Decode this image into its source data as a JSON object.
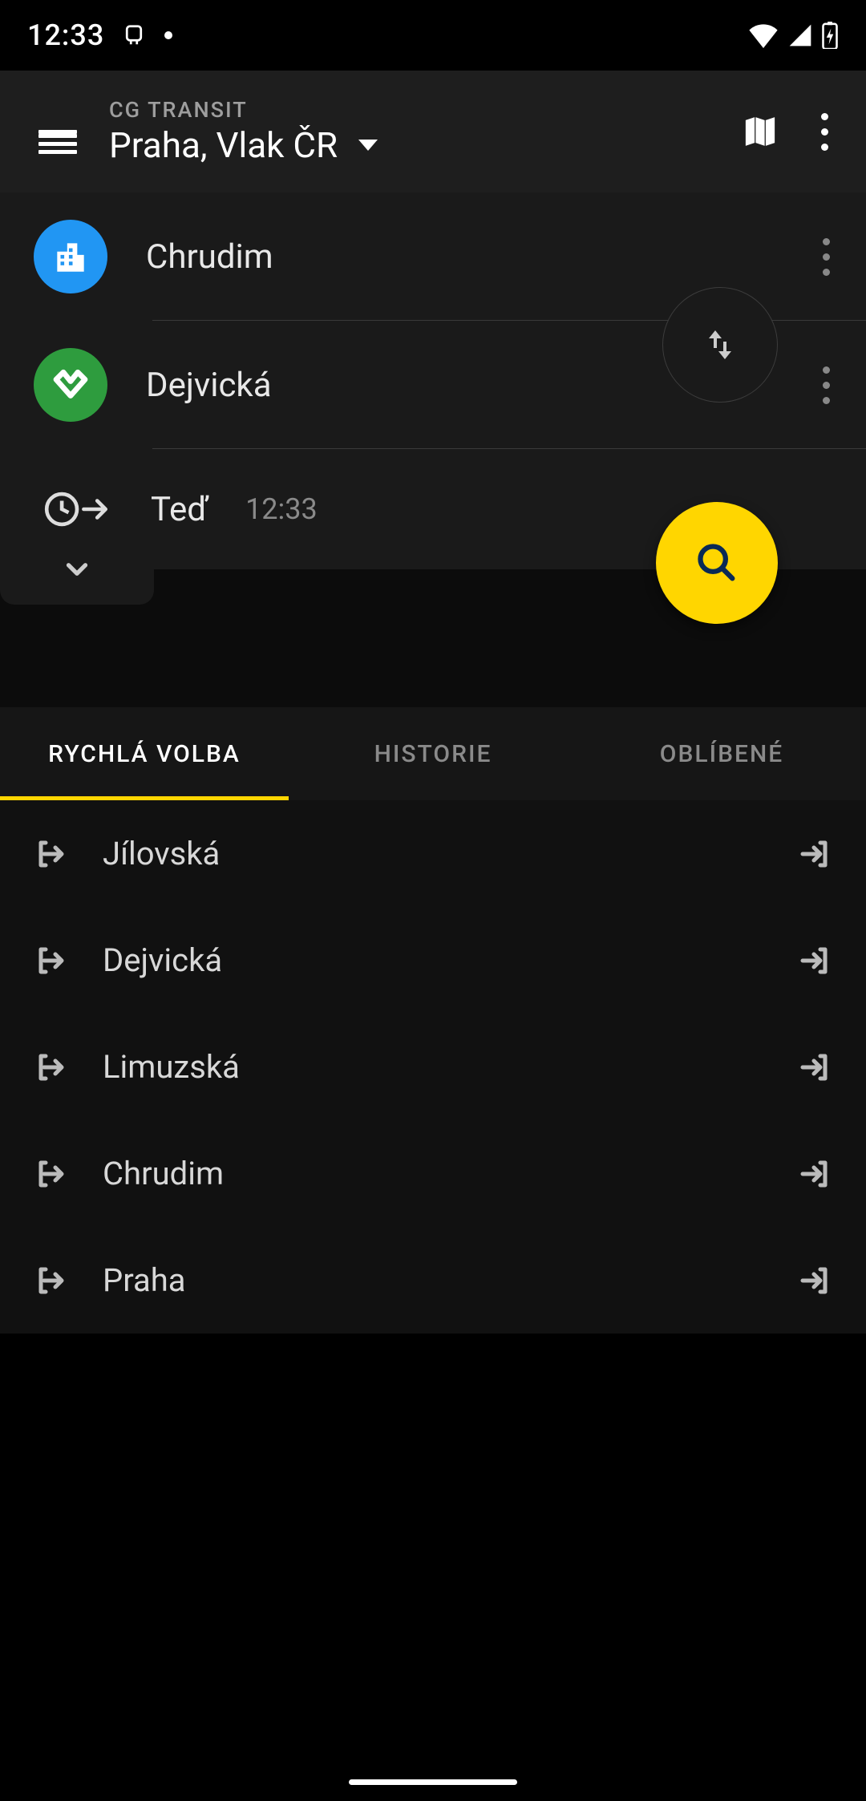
{
  "status": {
    "time": "12:33"
  },
  "appbar": {
    "app_name": "CG TRANSIT",
    "region": "Praha, Vlak ČR"
  },
  "search": {
    "from": "Chrudim",
    "to": "Dejvická",
    "time_label": "Teď",
    "time_value": "12:33"
  },
  "tabs": {
    "quick": "RYCHLÁ VOLBA",
    "history": "HISTORIE",
    "favorites": "OBLÍBENÉ"
  },
  "quick_list": {
    "0": {
      "label": "Jílovská"
    },
    "1": {
      "label": "Dejvická"
    },
    "2": {
      "label": "Limuzská"
    },
    "3": {
      "label": "Chrudim"
    },
    "4": {
      "label": "Praha"
    }
  }
}
